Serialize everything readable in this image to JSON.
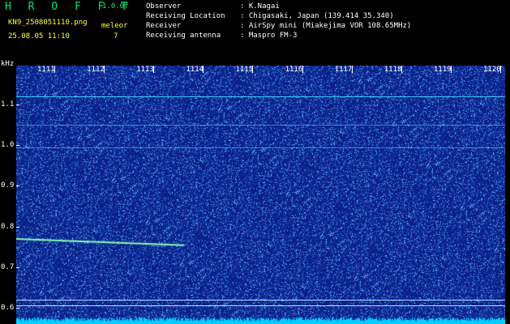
{
  "header": {
    "app_title": "H R O F F T",
    "version": "1.0.0f",
    "file_name": "KN9_2508051110.png",
    "station_label": "meleor",
    "timestamp": "25.08.05 11:10",
    "station_value": "7"
  },
  "info": {
    "observer_label": "Observer",
    "observer_value": ": K.Nagai",
    "location_label": "Receiving Location",
    "location_value": ": Chigasaki, Japan (139.414 35.340)",
    "receiver_label": "Receiver",
    "receiver_value": ": AirSpy mini (Miakejima VOR 108.65MHz)",
    "antenna_label": "Receiving antenna",
    "antenna_value": ": Maspro FM-3"
  },
  "axes": {
    "y_unit": "kHz",
    "y_ticks": [
      "1.1",
      "1.0",
      "0.9",
      "0.8",
      "0.7",
      "0.6"
    ],
    "y_values": [
      1.1,
      1.0,
      0.9,
      0.8,
      0.7,
      0.6
    ],
    "x_ticks": [
      "1111",
      "1112",
      "1113",
      "1114",
      "1115",
      "1116",
      "1117",
      "1118",
      "1119",
      "1120"
    ],
    "x_values": [
      1111,
      1112,
      1113,
      1114,
      1115,
      1116,
      1117,
      1118,
      1119,
      1120
    ]
  },
  "signals": {
    "carrier_khz": [
      1.12,
      1.05,
      0.995
    ],
    "meteor_echo": {
      "start_time": 1110.3,
      "end_time": 1113.8,
      "start_khz": 0.77,
      "end_khz": 0.754
    },
    "reference_lines_khz": [
      0.62,
      0.605
    ]
  },
  "colors": {
    "background": "#000000",
    "plot_background": "#0b1f86",
    "noise_bright": "#7fd0ff",
    "carrier": "#40d8ff",
    "echo": "#8cffb0",
    "floor": "#00cfff",
    "title_green": "#00e676",
    "label_yellow": "#ffff3c"
  }
}
